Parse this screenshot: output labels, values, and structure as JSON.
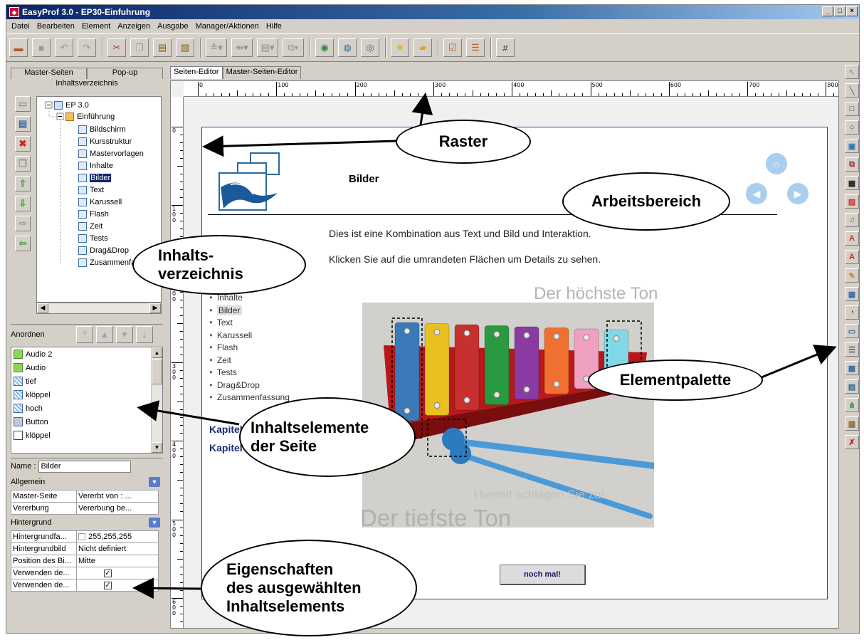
{
  "window": {
    "title": "EasyProf 3.0 - EP30-Einfuhrung",
    "app_icon": "easyprof-app-icon",
    "controls": [
      "_",
      "□",
      "×"
    ]
  },
  "menu": [
    "Datei",
    "Bearbeiten",
    "Element",
    "Anzeigen",
    "Ausgabe",
    "Manager/Aktionen",
    "Hilfe"
  ],
  "toolbar": [
    {
      "icon": "rubber-stamp-icon",
      "glyph": "▬",
      "color": "#b05a2a"
    },
    {
      "icon": "save-icon",
      "glyph": "■",
      "color": "#9a9a9a"
    },
    {
      "icon": "undo-icon",
      "glyph": "↶",
      "color": "#9a9a9a"
    },
    {
      "icon": "redo-icon",
      "glyph": "↷",
      "color": "#9a9a9a"
    },
    {
      "sep": true
    },
    {
      "icon": "cut-icon",
      "glyph": "✂",
      "color": "#b03030"
    },
    {
      "icon": "copy-icon",
      "glyph": "❐",
      "color": "#9a9a9a"
    },
    {
      "icon": "paste-icon",
      "glyph": "▤",
      "color": "#806020"
    },
    {
      "icon": "paste-special-icon",
      "glyph": "▧",
      "color": "#806020"
    },
    {
      "sep": true
    },
    {
      "icon": "align-dropdown-icon",
      "glyph": "≛▾",
      "color": "#909090"
    },
    {
      "icon": "distribute-dropdown-icon",
      "glyph": "⇹▾",
      "color": "#909090"
    },
    {
      "icon": "size-dropdown-icon",
      "glyph": "▤▾",
      "color": "#909090"
    },
    {
      "icon": "layer-dropdown-icon",
      "glyph": "⧉▾",
      "color": "#909090"
    },
    {
      "sep": true
    },
    {
      "icon": "preview-icon",
      "glyph": "◉",
      "color": "#2a8a3a"
    },
    {
      "icon": "publish-web-icon",
      "glyph": "◍",
      "color": "#2a6a9a"
    },
    {
      "icon": "export-icon",
      "glyph": "◎",
      "color": "#2a6a9a"
    },
    {
      "sep": true
    },
    {
      "icon": "star-icon",
      "glyph": "★",
      "color": "#e0b020"
    },
    {
      "icon": "folder-star-icon",
      "glyph": "▰",
      "color": "#e0a020"
    },
    {
      "sep": true
    },
    {
      "icon": "edit-check-icon",
      "glyph": "☑",
      "color": "#c06020"
    },
    {
      "icon": "form-icon",
      "glyph": "☰",
      "color": "#c06020"
    },
    {
      "sep": true
    },
    {
      "icon": "grid-icon",
      "glyph": "#",
      "color": "#404040"
    }
  ],
  "left_panel": {
    "tabs": [
      "Master-Seiten",
      "Pop-up"
    ],
    "section_title": "Inhaltsverzeichnis",
    "nav_buttons": [
      {
        "icon": "new-page-icon",
        "glyph": "▭",
        "color": "#909090"
      },
      {
        "icon": "page-icon",
        "glyph": "▤",
        "color": "#3a6ea5"
      },
      {
        "icon": "delete-icon",
        "glyph": "✖",
        "color": "#d02020"
      },
      {
        "icon": "copy-page-icon",
        "glyph": "❐",
        "color": "#909090"
      },
      {
        "icon": "move-up-icon",
        "glyph": "⇧",
        "color": "#40a040"
      },
      {
        "icon": "move-down-icon",
        "glyph": "⇩",
        "color": "#40a040"
      },
      {
        "icon": "indent-icon",
        "glyph": "⇨",
        "color": "#a0a0a0"
      },
      {
        "icon": "outdent-icon",
        "glyph": "⇦",
        "color": "#40a040"
      }
    ],
    "tree": {
      "root": "EP 3.0",
      "chapter": "Einführung",
      "pages": [
        "Bildschirm",
        "Kursstruktur",
        "Mastervorlagen",
        "Inhalte",
        "Bilder",
        "Text",
        "Karussell",
        "Flash",
        "Zeit",
        "Tests",
        "Drag&Drop",
        "Zusammenfassun"
      ],
      "selected": "Bilder"
    },
    "arrange": {
      "label": "Anordnen",
      "buttons": [
        {
          "icon": "bring-to-front-icon",
          "glyph": "⤒"
        },
        {
          "icon": "bring-forward-icon",
          "glyph": "▲"
        },
        {
          "icon": "send-backward-icon",
          "glyph": "▼"
        },
        {
          "icon": "send-to-back-icon",
          "glyph": "⤓"
        }
      ]
    },
    "elements": [
      {
        "label": "Audio 2",
        "kind": "audio"
      },
      {
        "label": "Audio",
        "kind": "audio"
      },
      {
        "label": "tief",
        "kind": "hotspot"
      },
      {
        "label": "klöppel",
        "kind": "hotspot"
      },
      {
        "label": "hoch",
        "kind": "hotspot"
      },
      {
        "label": "Button",
        "kind": "button"
      },
      {
        "label": "klöppel",
        "kind": "checkbox"
      }
    ],
    "properties": {
      "name_label": "Name :",
      "name_value": "Bilder",
      "sections": [
        {
          "title": "Allgemein",
          "rows": [
            [
              "Master-Seite",
              "Vererbt von : ..."
            ],
            [
              "Vererbung",
              "Vererbung be..."
            ]
          ]
        },
        {
          "title": "Hintergrund",
          "rows": [
            [
              "Hintergrundfa...",
              "255,255,255"
            ],
            [
              "Hintergrundbild",
              "Nicht definiert"
            ],
            [
              "Position des Bi...",
              "Mitte"
            ],
            [
              "Verwenden de...",
              "✓"
            ],
            [
              "Verwenden de...",
              "✓"
            ]
          ]
        }
      ]
    }
  },
  "editor": {
    "tabs": [
      "Seiten-Editor",
      "Master-Seiten-Editor"
    ],
    "active_tab": "Seiten-Editor",
    "ruler_h": [
      "0",
      "100",
      "200",
      "300",
      "400",
      "500",
      "600",
      "700",
      "800"
    ],
    "ruler_v": [
      "0",
      "100",
      "200",
      "300",
      "400",
      "500",
      "600"
    ],
    "page": {
      "title": "Bilder",
      "intro1": "Dies ist eine Kombination aus Text und Bild und Interaktion.",
      "intro2": "Klicken Sie auf die umrandeten Flächen um Details zu sehen.",
      "kapitel1": "Kapitel 1",
      "kapitel2": "Kapitel 2",
      "kapitel3": "Kapitel 3",
      "chapter_items": [
        "Inhalte",
        "Bilder",
        "Text",
        "Karussell",
        "Flash",
        "Zeit",
        "Tests",
        "Drag&Drop",
        "Zusammenfassung"
      ],
      "selected_item": "Bilder",
      "hint_top": "Der höchste Ton",
      "hint_mid": "Hiermit schlagen Sie zu!",
      "hint_bottom": "Der tiefste Ton",
      "button": "noch mal!",
      "nav_icons": [
        "home-icon",
        "previous-icon",
        "next-icon"
      ],
      "bar_colors": [
        "#3a7ab8",
        "#e8c020",
        "#c83030",
        "#2a9a40",
        "#8a3aa0",
        "#f07030",
        "#f0a0c0",
        "#80d8e8"
      ]
    }
  },
  "palette": [
    {
      "icon": "pointer-tool-icon",
      "glyph": "↖",
      "color": "#a0a0a0"
    },
    {
      "icon": "line-tool-icon",
      "glyph": "╲",
      "color": "#808080"
    },
    {
      "icon": "rectangle-tool-icon",
      "glyph": "□",
      "color": "#404040"
    },
    {
      "icon": "ellipse-tool-icon",
      "glyph": "○",
      "color": "#404040"
    },
    {
      "icon": "image-tool-icon",
      "glyph": "▣",
      "color": "#2a7ab0"
    },
    {
      "icon": "image-set-tool-icon",
      "glyph": "⧉",
      "color": "#a03030"
    },
    {
      "icon": "video-tool-icon",
      "glyph": "▦",
      "color": "#202020"
    },
    {
      "icon": "flash-tool-icon",
      "glyph": "▨",
      "color": "#d03030"
    },
    {
      "icon": "audio-tool-icon",
      "glyph": "♫",
      "color": "#3a9a2a"
    },
    {
      "icon": "text-art-tool-icon",
      "glyph": "A",
      "color": "#c03030"
    },
    {
      "icon": "text-tool-icon",
      "glyph": "A",
      "color": "#d02020"
    },
    {
      "icon": "note-tool-icon",
      "glyph": "✎",
      "color": "#c09020"
    },
    {
      "icon": "table-tool-icon",
      "glyph": "▦",
      "color": "#3a6ea5"
    },
    {
      "icon": "carousel-tool-icon",
      "glyph": "◔",
      "color": "#404040"
    },
    {
      "icon": "button-tool-icon",
      "glyph": "▭",
      "color": "#3a6ea5"
    },
    {
      "icon": "list-tool-icon",
      "glyph": "☰",
      "color": "#606060"
    },
    {
      "icon": "hotspot-tool-icon",
      "glyph": "▩",
      "color": "#3a6ea5"
    },
    {
      "icon": "document-tool-icon",
      "glyph": "▤",
      "color": "#2a6a9a"
    },
    {
      "icon": "structure-tool-icon",
      "glyph": "⋔",
      "color": "#2a8a3a"
    },
    {
      "icon": "clipboard-tool-icon",
      "glyph": "▥",
      "color": "#806020"
    },
    {
      "icon": "test-tool-icon",
      "glyph": "✗",
      "color": "#c02020"
    }
  ],
  "annotations": {
    "raster": "Raster",
    "arbeitsbereich": "Arbeitsbereich",
    "inhaltsverzeichnis_1": "Inhalts-",
    "inhaltsverzeichnis_2": "verzeichnis",
    "elementpalette": "Elementpalette",
    "inhaltselemente_1": "Inhaltselemente",
    "inhaltselemente_2": "der Seite",
    "eigenschaften_1": "Eigenschaften",
    "eigenschaften_2": "des ausgewählten",
    "eigenschaften_3": "Inhaltselements"
  }
}
